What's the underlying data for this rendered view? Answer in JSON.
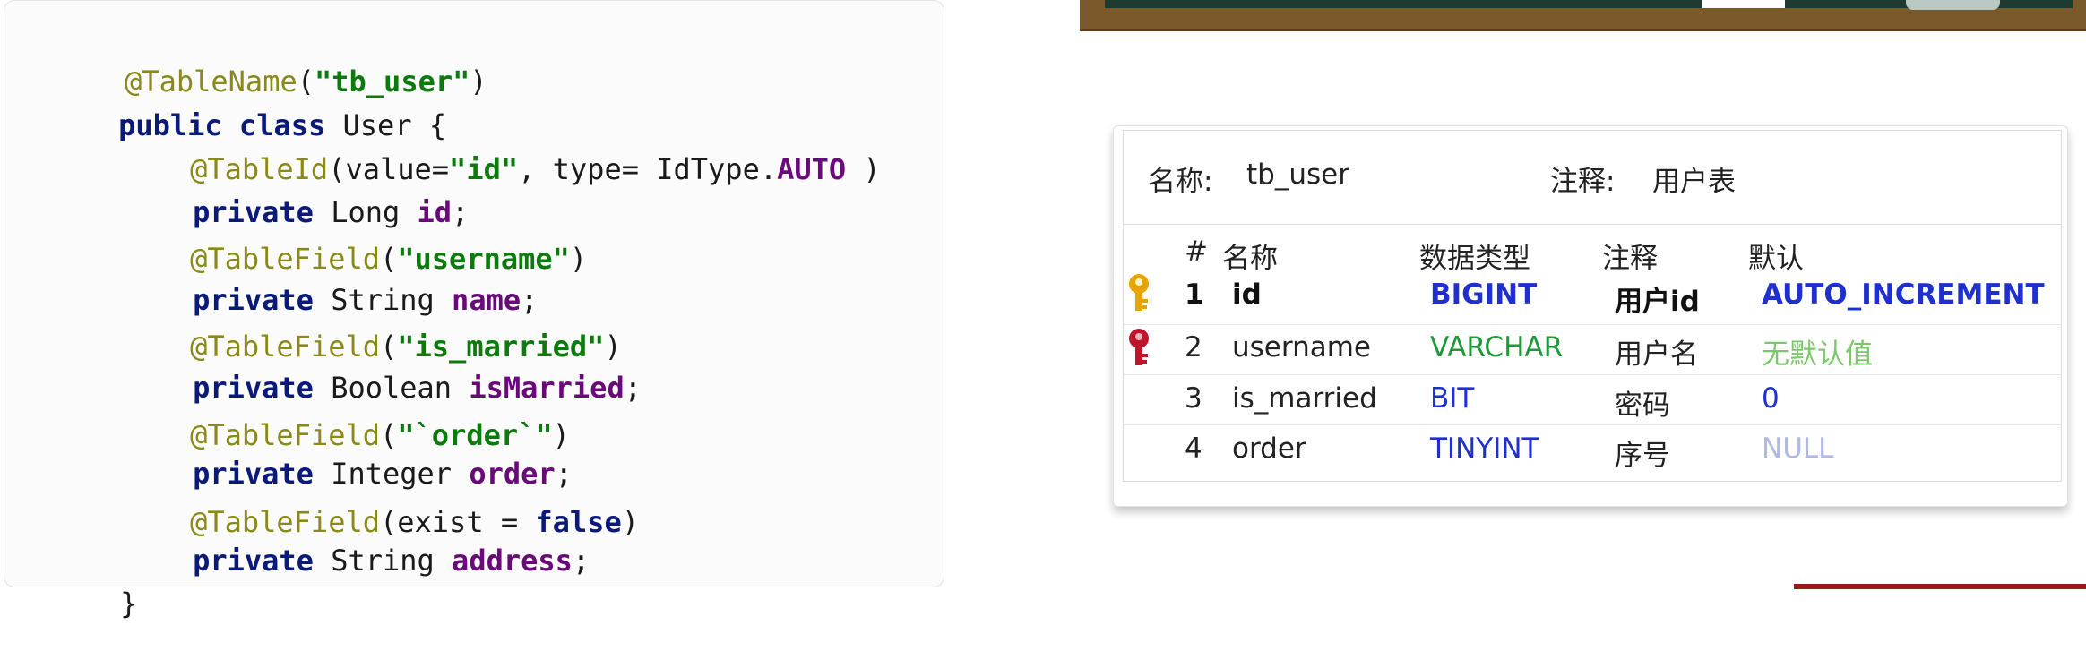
{
  "code": {
    "annotation_table": "@TableName",
    "table_name": "\"tb_user\"",
    "kw_public": "public",
    "kw_class": "class",
    "class_name": "User",
    "open_brace": "{",
    "close_brace": "}",
    "annotation_id": "@TableId",
    "id_args_pre": "(value=",
    "id_value": "\"id\"",
    "id_args_mid": ", type= IdType.",
    "id_type": "AUTO",
    "id_args_post": ")",
    "kw_private": "private",
    "annotation_field": "@TableField",
    "kw_false": "false",
    "type_long": "Long",
    "type_string": "String",
    "type_boolean": "Boolean",
    "type_integer": "Integer",
    "field_id": "id",
    "field_name": "name",
    "field_married": "isMarried",
    "field_order": "order",
    "field_address": "address",
    "col_username": "\"username\"",
    "col_is_married": "\"is_married\"",
    "col_order": "\"`order`\"",
    "exist_arg": "(exist = ",
    "close_paren": ")",
    "open_paren": "(",
    "semicolon": ";"
  },
  "table": {
    "name_label": "名称:",
    "name_value": "tb_user",
    "comment_label": "注释:",
    "comment_value": "用户表",
    "columns": [
      "#",
      "名称",
      "数据类型",
      "注释",
      "默认"
    ],
    "rows": [
      {
        "num": "1",
        "name": "id",
        "type": "BIGINT",
        "comment": "用户id",
        "default": "AUTO_INCREMENT",
        "icon": "primary-key-icon",
        "bold": true
      },
      {
        "num": "2",
        "name": "username",
        "type": "VARCHAR",
        "comment": "用户名",
        "default": "无默认值",
        "icon": "unique-key-icon",
        "bold": false
      },
      {
        "num": "3",
        "name": "is_married",
        "type": "BIT",
        "comment": "密码",
        "default": "0",
        "icon": "",
        "bold": false
      },
      {
        "num": "4",
        "name": "order",
        "type": "TINYINT",
        "comment": "序号",
        "default": "NULL",
        "icon": "",
        "bold": false
      }
    ]
  },
  "colors": {
    "keyword": "#0a1a7a",
    "annotation": "#8a8a1a",
    "string": "#0c7a0c",
    "field": "#6a0a7a",
    "type_blue": "#1f2fd0",
    "type_green": "#1f9a3a",
    "default_green": "#7ac86a",
    "default_null": "#b0b8e8",
    "primary_key": "#e8a400",
    "unique_key": "#c0142a"
  }
}
